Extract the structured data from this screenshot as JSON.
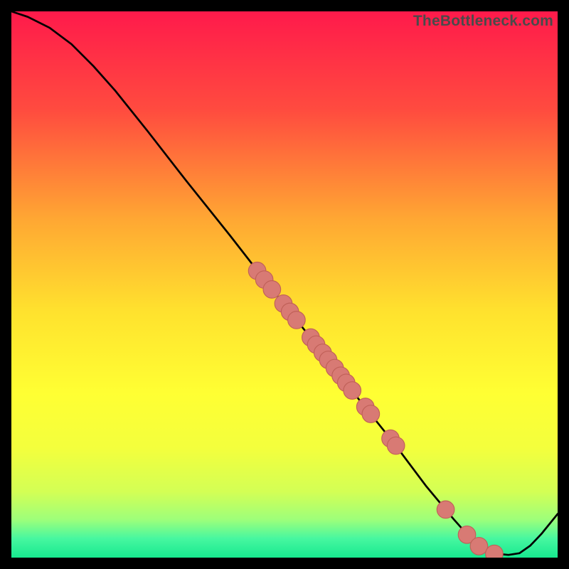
{
  "watermark": "TheBottleneck.com",
  "colors": {
    "bg": "#000000",
    "curve": "#000000",
    "dot_fill": "#d87a74",
    "dot_stroke": "#c06058"
  },
  "chart_data": {
    "type": "line",
    "title": "",
    "xlabel": "",
    "ylabel": "",
    "xlim": [
      0,
      100
    ],
    "ylim": [
      0,
      100
    ],
    "gradient_stops": [
      {
        "offset": 0.0,
        "color": "#ff1a4b"
      },
      {
        "offset": 0.18,
        "color": "#ff4b3f"
      },
      {
        "offset": 0.38,
        "color": "#ffa733"
      },
      {
        "offset": 0.55,
        "color": "#ffe22e"
      },
      {
        "offset": 0.7,
        "color": "#ffff33"
      },
      {
        "offset": 0.8,
        "color": "#f3ff3d"
      },
      {
        "offset": 0.88,
        "color": "#d3ff55"
      },
      {
        "offset": 0.93,
        "color": "#9eff7a"
      },
      {
        "offset": 0.965,
        "color": "#47f7a0"
      },
      {
        "offset": 1.0,
        "color": "#17e98f"
      }
    ],
    "curve": [
      {
        "x": 0,
        "y": 100
      },
      {
        "x": 3,
        "y": 99
      },
      {
        "x": 7,
        "y": 97
      },
      {
        "x": 11,
        "y": 94
      },
      {
        "x": 15,
        "y": 90
      },
      {
        "x": 19,
        "y": 85.5
      },
      {
        "x": 25,
        "y": 78
      },
      {
        "x": 32,
        "y": 69
      },
      {
        "x": 40,
        "y": 59
      },
      {
        "x": 47,
        "y": 50
      },
      {
        "x": 55,
        "y": 40
      },
      {
        "x": 62,
        "y": 31
      },
      {
        "x": 70,
        "y": 21
      },
      {
        "x": 76,
        "y": 13
      },
      {
        "x": 81,
        "y": 7
      },
      {
        "x": 85,
        "y": 2.5
      },
      {
        "x": 88,
        "y": 0.8
      },
      {
        "x": 91,
        "y": 0.5
      },
      {
        "x": 93,
        "y": 0.8
      },
      {
        "x": 95,
        "y": 2.2
      },
      {
        "x": 97,
        "y": 4.3
      },
      {
        "x": 100,
        "y": 8
      }
    ],
    "dots": [
      {
        "x": 45.0,
        "y": 52.5
      },
      {
        "x": 46.3,
        "y": 50.9
      },
      {
        "x": 47.7,
        "y": 49.1
      },
      {
        "x": 49.8,
        "y": 46.5
      },
      {
        "x": 51.0,
        "y": 45.0
      },
      {
        "x": 52.2,
        "y": 43.5
      },
      {
        "x": 54.8,
        "y": 40.3
      },
      {
        "x": 55.8,
        "y": 39.0
      },
      {
        "x": 57.0,
        "y": 37.5
      },
      {
        "x": 58.0,
        "y": 36.2
      },
      {
        "x": 59.2,
        "y": 34.7
      },
      {
        "x": 60.3,
        "y": 33.3
      },
      {
        "x": 61.3,
        "y": 32.0
      },
      {
        "x": 62.4,
        "y": 30.6
      },
      {
        "x": 64.8,
        "y": 27.6
      },
      {
        "x": 65.8,
        "y": 26.3
      },
      {
        "x": 69.4,
        "y": 21.8
      },
      {
        "x": 70.4,
        "y": 20.5
      },
      {
        "x": 79.5,
        "y": 8.8
      },
      {
        "x": 83.4,
        "y": 4.2
      },
      {
        "x": 85.6,
        "y": 2.1
      },
      {
        "x": 88.4,
        "y": 0.7
      }
    ],
    "dot_radius": 1.6
  }
}
